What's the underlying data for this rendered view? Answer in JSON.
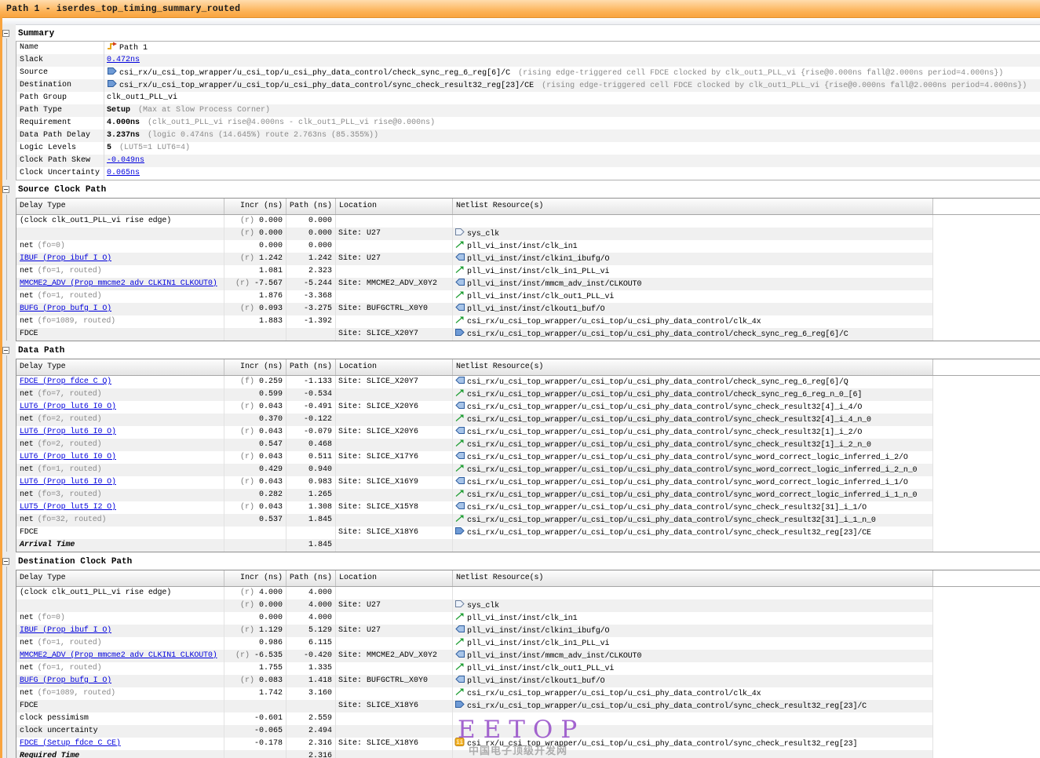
{
  "window": {
    "title": "Path 1 - iserdes_top_timing_summary_routed"
  },
  "colors": {
    "titlebar_orange": "#fcb052",
    "accent_orange": "#f9a43e",
    "link_blue": "#0000dd",
    "row_stripe": "#f0f0f0",
    "net_green": "#1e9e32",
    "pin_blue": "#6f9bd6",
    "watermark_purple": "#944ac8"
  },
  "summary": {
    "section_title": "Summary",
    "rows": [
      {
        "label": "Name",
        "icon": "path",
        "segments": [
          {
            "text": "Path 1",
            "style": "plain"
          }
        ]
      },
      {
        "label": "Slack",
        "segments": [
          {
            "text": "0.472ns",
            "style": "link"
          }
        ]
      },
      {
        "label": "Source",
        "icon": "inpin",
        "segments": [
          {
            "text": "csi_rx/u_csi_top_wrapper/u_csi_top/u_csi_phy_data_control/check_sync_reg_6_reg[6]/C",
            "style": "plain"
          },
          {
            "text": "(rising edge-triggered cell FDCE clocked by clk_out1_PLL_vi  {rise@0.000ns fall@2.000ns period=4.000ns})",
            "style": "gray"
          }
        ]
      },
      {
        "label": "Destination",
        "icon": "inpin",
        "segments": [
          {
            "text": "csi_rx/u_csi_top_wrapper/u_csi_top/u_csi_phy_data_control/sync_check_result32_reg[23]/CE",
            "style": "plain"
          },
          {
            "text": "(rising edge-triggered cell FDCE clocked by clk_out1_PLL_vi  {rise@0.000ns fall@2.000ns period=4.000ns})",
            "style": "gray"
          }
        ]
      },
      {
        "label": "Path Group",
        "segments": [
          {
            "text": "clk_out1_PLL_vi",
            "style": "plain"
          }
        ]
      },
      {
        "label": "Path Type",
        "segments": [
          {
            "text": "Setup",
            "style": "bold"
          },
          {
            "text": "(Max at Slow Process Corner)",
            "style": "gray"
          }
        ]
      },
      {
        "label": "Requirement",
        "segments": [
          {
            "text": "4.000ns",
            "style": "bold"
          },
          {
            "text": "(clk_out1_PLL_vi rise@4.000ns - clk_out1_PLL_vi rise@0.000ns)",
            "style": "gray"
          }
        ]
      },
      {
        "label": "Data Path Delay",
        "segments": [
          {
            "text": "3.237ns",
            "style": "bold"
          },
          {
            "text": "(logic 0.474ns (14.645%)  route 2.763ns (85.355%))",
            "style": "gray"
          }
        ]
      },
      {
        "label": "Logic Levels",
        "segments": [
          {
            "text": "5",
            "style": "bold"
          },
          {
            "text": "(LUT5=1 LUT6=4)",
            "style": "gray"
          }
        ]
      },
      {
        "label": "Clock Path Skew",
        "segments": [
          {
            "text": "-0.049ns",
            "style": "link"
          }
        ]
      },
      {
        "label": "Clock Uncertainty",
        "segments": [
          {
            "text": "0.065ns",
            "style": "link"
          }
        ]
      }
    ]
  },
  "path_tables": [
    {
      "section_title": "Source Clock Path",
      "columns": [
        "Delay Type",
        "Incr (ns)",
        "Path (ns)",
        "Location",
        "Netlist Resource(s)"
      ],
      "rows": [
        {
          "d": "(clock clk_out1_PLL_vi rise edge)",
          "ip": "(r)",
          "iv": "0.000",
          "pv": "0.000"
        },
        {
          "d": "",
          "ip": "(r)",
          "iv": "0.000",
          "pv": "0.000",
          "loc": "Site: U27",
          "ni": "port",
          "nt": "sys_clk"
        },
        {
          "d": "net",
          "dn": "(fo=0)",
          "iv": "0.000",
          "pv": "0.000",
          "ni": "net",
          "nt": "pll_vi_inst/inst/clk_in1"
        },
        {
          "d": "IBUF (Prop ibuf I O)",
          "ds": "link",
          "ip": "(r)",
          "iv": "1.242",
          "pv": "1.242",
          "loc": "Site: U27",
          "ni": "outpin",
          "nt": "pll_vi_inst/inst/clkin1_ibufg/O"
        },
        {
          "d": "net",
          "dn": "(fo=1, routed)",
          "iv": "1.081",
          "pv": "2.323",
          "ni": "net",
          "nt": "pll_vi_inst/inst/clk_in1_PLL_vi"
        },
        {
          "d": "MMCME2_ADV (Prop mmcme2 adv CLKIN1 CLKOUT0)",
          "ds": "link",
          "ip": "(r)",
          "iv": "-7.567",
          "pv": "-5.244",
          "loc": "Site: MMCME2_ADV_X0Y2",
          "ni": "outpin",
          "nt": "pll_vi_inst/inst/mmcm_adv_inst/CLKOUT0"
        },
        {
          "d": "net",
          "dn": "(fo=1, routed)",
          "iv": "1.876",
          "pv": "-3.368",
          "ni": "net",
          "nt": "pll_vi_inst/inst/clk_out1_PLL_vi"
        },
        {
          "d": "BUFG (Prop bufg I O)",
          "ds": "link",
          "ip": "(r)",
          "iv": "0.093",
          "pv": "-3.275",
          "loc": "Site: BUFGCTRL_X0Y0",
          "ni": "outpin",
          "nt": "pll_vi_inst/inst/clkout1_buf/O"
        },
        {
          "d": "net",
          "dn": "(fo=1089, routed)",
          "iv": "1.883",
          "pv": "-1.392",
          "ni": "net",
          "nt": "csi_rx/u_csi_top_wrapper/u_csi_top/u_csi_phy_data_control/clk_4x"
        },
        {
          "d": "FDCE",
          "loc": "Site: SLICE_X20Y7",
          "ni": "inpin",
          "nt": "csi_rx/u_csi_top_wrapper/u_csi_top/u_csi_phy_data_control/check_sync_reg_6_reg[6]/C"
        }
      ]
    },
    {
      "section_title": "Data Path",
      "columns": [
        "Delay Type",
        "Incr (ns)",
        "Path (ns)",
        "Location",
        "Netlist Resource(s)"
      ],
      "rows": [
        {
          "d": "FDCE (Prop fdce C Q)",
          "ds": "link",
          "ip": "(f)",
          "iv": "0.259",
          "pv": "-1.133",
          "loc": "Site: SLICE_X20Y7",
          "ni": "outpin",
          "nt": "csi_rx/u_csi_top_wrapper/u_csi_top/u_csi_phy_data_control/check_sync_reg_6_reg[6]/Q"
        },
        {
          "d": "net",
          "dn": "(fo=7, routed)",
          "iv": "0.599",
          "pv": "-0.534",
          "ni": "net",
          "nt": "csi_rx/u_csi_top_wrapper/u_csi_top/u_csi_phy_data_control/check_sync_reg_6_reg_n_0_[6]"
        },
        {
          "d": "LUT6 (Prop lut6 I0 O)",
          "ds": "link",
          "ip": "(r)",
          "iv": "0.043",
          "pv": "-0.491",
          "loc": "Site: SLICE_X20Y6",
          "ni": "outpin",
          "nt": "csi_rx/u_csi_top_wrapper/u_csi_top/u_csi_phy_data_control/sync_check_result32[4]_i_4/O"
        },
        {
          "d": "net",
          "dn": "(fo=2, routed)",
          "iv": "0.370",
          "pv": "-0.122",
          "ni": "net",
          "nt": "csi_rx/u_csi_top_wrapper/u_csi_top/u_csi_phy_data_control/sync_check_result32[4]_i_4_n_0"
        },
        {
          "d": "LUT6 (Prop lut6 I0 O)",
          "ds": "link",
          "ip": "(r)",
          "iv": "0.043",
          "pv": "-0.079",
          "loc": "Site: SLICE_X20Y6",
          "ni": "outpin",
          "nt": "csi_rx/u_csi_top_wrapper/u_csi_top/u_csi_phy_data_control/sync_check_result32[1]_i_2/O"
        },
        {
          "d": "net",
          "dn": "(fo=2, routed)",
          "iv": "0.547",
          "pv": "0.468",
          "ni": "net",
          "nt": "csi_rx/u_csi_top_wrapper/u_csi_top/u_csi_phy_data_control/sync_check_result32[1]_i_2_n_0"
        },
        {
          "d": "LUT6 (Prop lut6 I0 O)",
          "ds": "link",
          "ip": "(r)",
          "iv": "0.043",
          "pv": "0.511",
          "loc": "Site: SLICE_X17Y6",
          "ni": "outpin",
          "nt": "csi_rx/u_csi_top_wrapper/u_csi_top/u_csi_phy_data_control/sync_word_correct_logic_inferred_i_2/O"
        },
        {
          "d": "net",
          "dn": "(fo=1, routed)",
          "iv": "0.429",
          "pv": "0.940",
          "ni": "net",
          "nt": "csi_rx/u_csi_top_wrapper/u_csi_top/u_csi_phy_data_control/sync_word_correct_logic_inferred_i_2_n_0"
        },
        {
          "d": "LUT6 (Prop lut6 I0 O)",
          "ds": "link",
          "ip": "(r)",
          "iv": "0.043",
          "pv": "0.983",
          "loc": "Site: SLICE_X16Y9",
          "ni": "outpin",
          "nt": "csi_rx/u_csi_top_wrapper/u_csi_top/u_csi_phy_data_control/sync_word_correct_logic_inferred_i_1/O"
        },
        {
          "d": "net",
          "dn": "(fo=3, routed)",
          "iv": "0.282",
          "pv": "1.265",
          "ni": "net",
          "nt": "csi_rx/u_csi_top_wrapper/u_csi_top/u_csi_phy_data_control/sync_word_correct_logic_inferred_i_1_n_0"
        },
        {
          "d": "LUT5 (Prop lut5 I2 O)",
          "ds": "link",
          "ip": "(r)",
          "iv": "0.043",
          "pv": "1.308",
          "loc": "Site: SLICE_X15Y8",
          "ni": "outpin",
          "nt": "csi_rx/u_csi_top_wrapper/u_csi_top/u_csi_phy_data_control/sync_check_result32[31]_i_1/O"
        },
        {
          "d": "net",
          "dn": "(fo=32, routed)",
          "iv": "0.537",
          "pv": "1.845",
          "ni": "net",
          "nt": "csi_rx/u_csi_top_wrapper/u_csi_top/u_csi_phy_data_control/sync_check_result32[31]_i_1_n_0"
        },
        {
          "d": "FDCE",
          "loc": "Site: SLICE_X18Y6",
          "ni": "inpin",
          "nt": "csi_rx/u_csi_top_wrapper/u_csi_top/u_csi_phy_data_control/sync_check_result32_reg[23]/CE"
        },
        {
          "d": "Arrival Time",
          "ds": "total",
          "pv": "1.845"
        }
      ]
    },
    {
      "section_title": "Destination Clock Path",
      "columns": [
        "Delay Type",
        "Incr (ns)",
        "Path (ns)",
        "Location",
        "Netlist Resource(s)"
      ],
      "rows": [
        {
          "d": "(clock clk_out1_PLL_vi rise edge)",
          "ip": "(r)",
          "iv": "4.000",
          "pv": "4.000"
        },
        {
          "d": "",
          "ip": "(r)",
          "iv": "0.000",
          "pv": "4.000",
          "loc": "Site: U27",
          "ni": "port",
          "nt": "sys_clk"
        },
        {
          "d": "net",
          "dn": "(fo=0)",
          "iv": "0.000",
          "pv": "4.000",
          "ni": "net",
          "nt": "pll_vi_inst/inst/clk_in1"
        },
        {
          "d": "IBUF (Prop ibuf I O)",
          "ds": "link",
          "ip": "(r)",
          "iv": "1.129",
          "pv": "5.129",
          "loc": "Site: U27",
          "ni": "outpin",
          "nt": "pll_vi_inst/inst/clkin1_ibufg/O"
        },
        {
          "d": "net",
          "dn": "(fo=1, routed)",
          "iv": "0.986",
          "pv": "6.115",
          "ni": "net",
          "nt": "pll_vi_inst/inst/clk_in1_PLL_vi"
        },
        {
          "d": "MMCME2_ADV (Prop mmcme2 adv CLKIN1 CLKOUT0)",
          "ds": "link",
          "ip": "(r)",
          "iv": "-6.535",
          "pv": "-0.420",
          "loc": "Site: MMCME2_ADV_X0Y2",
          "ni": "outpin",
          "nt": "pll_vi_inst/inst/mmcm_adv_inst/CLKOUT0"
        },
        {
          "d": "net",
          "dn": "(fo=1, routed)",
          "iv": "1.755",
          "pv": "1.335",
          "ni": "net",
          "nt": "pll_vi_inst/inst/clk_out1_PLL_vi"
        },
        {
          "d": "BUFG (Prop bufg I O)",
          "ds": "link",
          "ip": "(r)",
          "iv": "0.083",
          "pv": "1.418",
          "loc": "Site: BUFGCTRL_X0Y0",
          "ni": "outpin",
          "nt": "pll_vi_inst/inst/clkout1_buf/O"
        },
        {
          "d": "net",
          "dn": "(fo=1089, routed)",
          "iv": "1.742",
          "pv": "3.160",
          "ni": "net",
          "nt": "csi_rx/u_csi_top_wrapper/u_csi_top/u_csi_phy_data_control/clk_4x"
        },
        {
          "d": "FDCE",
          "loc": "Site: SLICE_X18Y6",
          "ni": "inpin",
          "nt": "csi_rx/u_csi_top_wrapper/u_csi_top/u_csi_phy_data_control/sync_check_result32_reg[23]/C"
        },
        {
          "d": "clock pessimism",
          "iv": "-0.601",
          "pv": "2.559"
        },
        {
          "d": "clock uncertainty",
          "iv": "-0.065",
          "pv": "2.494"
        },
        {
          "d": "FDCE (Setup fdce C CE)",
          "ds": "link",
          "iv": "-0.178",
          "pv": "2.316",
          "loc": "Site: SLICE_X18Y6",
          "ni": "cell",
          "nt": "csi_rx/u_csi_top_wrapper/u_csi_top/u_csi_phy_data_control/sync_check_result32_reg[23]"
        },
        {
          "d": "Required Time",
          "ds": "total",
          "pv": "2.316"
        }
      ]
    }
  ],
  "watermark": {
    "line1": "EETOP",
    "line2": "中国电子顶级开发网"
  }
}
